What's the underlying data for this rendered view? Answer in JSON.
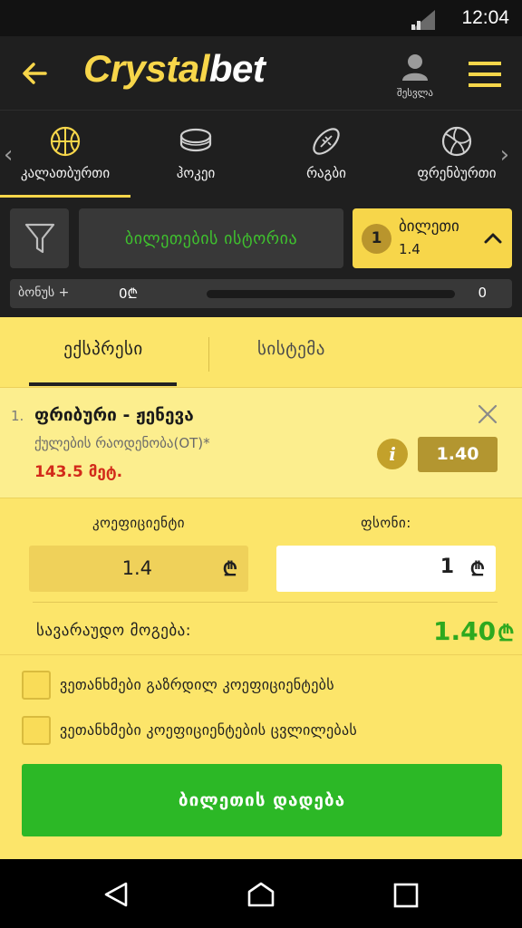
{
  "status_bar": {
    "time": "12:04"
  },
  "header": {
    "logo_part1": "Crystal",
    "logo_part2": "bet",
    "profile_label": "შესვლა"
  },
  "sports_tabs": [
    {
      "label": "კალათბურთი",
      "icon": "basketball-icon",
      "active": true
    },
    {
      "label": "ჰოკეი",
      "icon": "hockey-puck-icon",
      "active": false
    },
    {
      "label": "რაგბი",
      "icon": "rugby-ball-icon",
      "active": false
    },
    {
      "label": "ფრენბურთი",
      "icon": "volleyball-icon",
      "active": false
    }
  ],
  "toolbar": {
    "history_label": "ბილეთების ისტორია",
    "ticket_count": "1",
    "ticket_label": "ბილეთი",
    "ticket_odds": "1.4"
  },
  "bonus": {
    "label": "ბონუს +",
    "amount": "0₾",
    "progress_value": "0",
    "progress_fraction": 0
  },
  "slip": {
    "tabs": [
      "ექსპრესი",
      "სისტემა"
    ],
    "active_tab": 0,
    "bet": {
      "number": "1.",
      "match": "ფრიბური - ჟენევა",
      "market": "ქულების რაოდენობა(OT)*",
      "pick": "143.5 მეტ.",
      "odds": "1.40"
    },
    "coef_label": "კოეფიციენტი",
    "coef_value": "1.4",
    "stake_label": "ფსონი:",
    "stake_value": "1",
    "currency": "₾",
    "win_label": "სავარაუდო მოგება:",
    "win_value": "1.40",
    "checkbox_1": "ვეთანხმები გაზრდილ კოეფიციენტებს",
    "checkbox_2": "ვეთანხმები კოეფიციენტების ცვლილებას",
    "place_button": "ბილეთის დადება"
  },
  "colors": {
    "brand_yellow": "#f7d64a",
    "slip_yellow": "#fce56a",
    "green": "#2cb826",
    "dark": "#1f1f1f"
  }
}
